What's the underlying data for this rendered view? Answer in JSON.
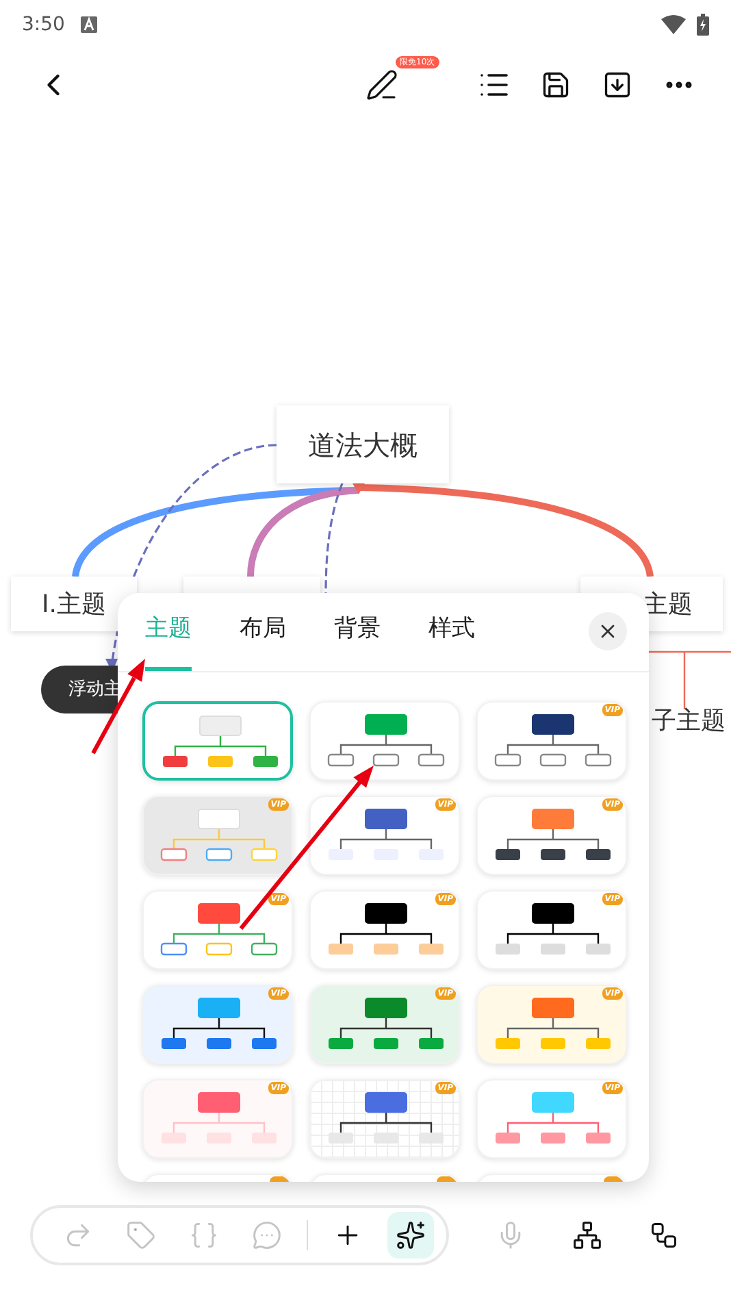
{
  "status_bar": {
    "time": "3:50"
  },
  "toolbar": {
    "pen_badge": "限免10次"
  },
  "mind_map": {
    "nodes": [
      {
        "kind": "root",
        "text": "道法大概"
      },
      {
        "kind": "topic",
        "text": "I.主题"
      },
      {
        "kind": "topic_hidden"
      },
      {
        "kind": "topic_right",
        "text": "主题"
      },
      {
        "kind": "floating",
        "text": "浮动主"
      },
      {
        "kind": "subtopic",
        "text": "子主题"
      }
    ]
  },
  "panel": {
    "tabs": [
      {
        "label": "主题",
        "selected": true
      },
      {
        "label": "布局",
        "selected": false
      },
      {
        "label": "背景",
        "selected": false
      },
      {
        "label": "样式",
        "selected": false
      }
    ],
    "themes": [
      {
        "selected": true
      },
      {
        "selected": false
      },
      {
        "selected": false,
        "badge": "VIP"
      },
      {
        "selected": false,
        "badge": "VIP"
      },
      {
        "selected": false,
        "badge": "VIP"
      },
      {
        "selected": false,
        "badge": "VIP"
      },
      {
        "selected": false,
        "badge": "VIP"
      },
      {
        "selected": false,
        "badge": "VIP"
      },
      {
        "selected": false,
        "badge": "VIP"
      },
      {
        "selected": false,
        "badge": "VIP"
      },
      {
        "selected": false,
        "badge": "VIP"
      },
      {
        "selected": false,
        "badge": "VIP"
      },
      {
        "selected": false,
        "badge": "VIP"
      },
      {
        "selected": false,
        "badge": "VIP"
      },
      {
        "selected": false,
        "badge": "VIP"
      },
      {
        "selected": false
      },
      {
        "selected": false
      },
      {
        "selected": false
      }
    ]
  },
  "bottom_toolbar": {
    "tools": [
      {
        "kind": "relation",
        "disabled": true,
        "selected": false
      },
      {
        "kind": "tag",
        "disabled": true,
        "selected": false
      },
      {
        "kind": "summary",
        "disabled": true,
        "selected": false
      },
      {
        "kind": "comment",
        "disabled": true,
        "selected": false
      },
      {
        "kind": "add",
        "disabled": false,
        "selected": false
      },
      {
        "kind": "ai",
        "disabled": false,
        "selected": true
      }
    ],
    "extras": [
      {
        "kind": "voice",
        "disabled": true
      },
      {
        "kind": "layout",
        "disabled": false
      },
      {
        "kind": "structure",
        "disabled": false
      }
    ]
  }
}
